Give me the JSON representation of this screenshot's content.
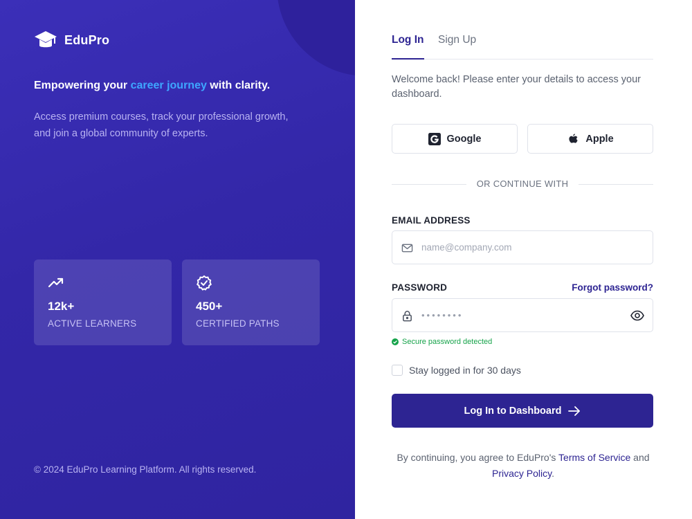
{
  "brand": {
    "name": "EduPro",
    "logo_icon": "graduation-cap-icon"
  },
  "hero": {
    "headline_pre": "Empowering your ",
    "headline_accent": "career journey",
    "headline_post": " with clarity.",
    "subtext": "Access premium courses, track your professional growth, and join a global community of experts."
  },
  "stats": [
    {
      "icon": "trending-up-icon",
      "value": "12k+",
      "label": "ACTIVE LEARNERS"
    },
    {
      "icon": "badge-check-icon",
      "value": "450+",
      "label": "CERTIFIED PATHS"
    }
  ],
  "footer": {
    "copyright": "© 2024 EduPro Learning Platform. All rights reserved."
  },
  "auth": {
    "tabs": [
      {
        "label": "Log In",
        "active": true
      },
      {
        "label": "Sign Up",
        "active": false
      }
    ],
    "welcome": "Welcome back! Please enter your details to access your dashboard.",
    "social": {
      "google_label": "Google",
      "apple_label": "Apple"
    },
    "divider_text": "OR CONTINUE WITH",
    "email": {
      "label": "EMAIL ADDRESS",
      "placeholder": "name@company.com",
      "value": ""
    },
    "password": {
      "label": "PASSWORD",
      "forgot_label": "Forgot password?",
      "masked_value": "••••••••"
    },
    "secure_note": "Secure password detected",
    "remember_label": "Stay logged in for 30 days",
    "remember_checked": false,
    "submit_label": "Log In to Dashboard",
    "legal_pre": "By continuing, you agree to EduPro's ",
    "terms_label": "Terms of Service",
    "legal_mid": " and ",
    "privacy_label": "Privacy Policy",
    "legal_post": "."
  },
  "colors": {
    "brand_primary": "#2d2492",
    "panel_bg": "#3327a8",
    "accent": "#3ea6ff",
    "success": "#16a34a"
  }
}
